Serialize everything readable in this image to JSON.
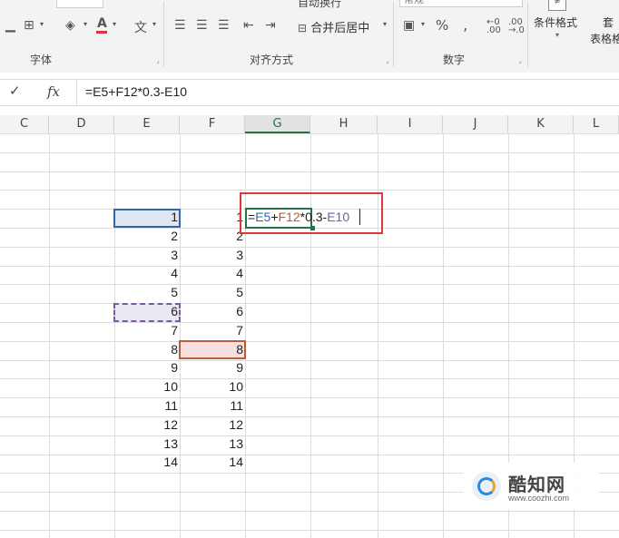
{
  "ribbon": {
    "groups": [
      {
        "label": "字体"
      },
      {
        "label": "对齐方式"
      },
      {
        "label": "数字"
      }
    ],
    "merge_center_label": "合并后居中",
    "wrap_text_label": "自动换行",
    "number_format_value": "常规",
    "percent_symbol": "%",
    "comma_symbol": "‚",
    "conditional_format_label": "条件格式",
    "table_format_label_top": "套",
    "table_format_label": "表格格"
  },
  "formula_bar": {
    "cancel_icon": "✓",
    "fx_label": "fx",
    "formula": "=E5+F12*0.3-E10"
  },
  "columns": [
    "C",
    "D",
    "E",
    "F",
    "G",
    "H",
    "I",
    "J",
    "K",
    "L"
  ],
  "selected_column": "G",
  "cells": {
    "E": [
      "1",
      "2",
      "3",
      "4",
      "5",
      "6",
      "7",
      "8",
      "9",
      "10",
      "11",
      "12",
      "13",
      "14"
    ],
    "F": [
      "1",
      "2",
      "3",
      "4",
      "5",
      "6",
      "7",
      "8",
      "9",
      "10",
      "11",
      "12",
      "13",
      "14"
    ]
  },
  "editing_cell": {
    "parts": [
      {
        "text": "=",
        "color": "#222222"
      },
      {
        "text": "E5",
        "color": "#3465a4"
      },
      {
        "text": "+",
        "color": "#222222"
      },
      {
        "text": "F12",
        "color": "#b85c3c"
      },
      {
        "text": "*0.3-",
        "color": "#222222"
      },
      {
        "text": "E10",
        "color": "#7a5aa0"
      }
    ]
  },
  "colors": {
    "excel_green": "#217346",
    "ref_blue": "#3465a4",
    "ref_red": "#b85c3c",
    "ref_purple": "#7a5aa0",
    "annotation_red": "#d9393a"
  },
  "watermark": {
    "brand": "酷知网",
    "url": "www.coozhi.com"
  }
}
